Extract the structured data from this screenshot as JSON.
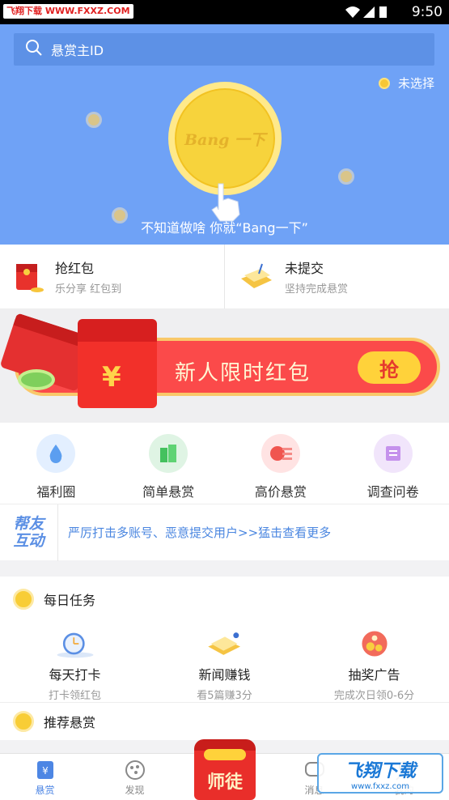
{
  "statusbar": {
    "watermark": "飞翔下载 WWW.FXXZ.COM",
    "time": "9:50"
  },
  "hero": {
    "search_placeholder": "悬赏主ID",
    "unselected_label": "未选择",
    "coin_text": "Bang 一下",
    "hint": "不知道做啥 你就“Bang一下”"
  },
  "quick": [
    {
      "title": "抢红包",
      "subtitle": "乐分享 红包到"
    },
    {
      "title": "未提交",
      "subtitle": "坚持完成悬赏"
    }
  ],
  "banner": {
    "text": "新人限时红包",
    "grab": "抢",
    "yen": "¥"
  },
  "categories": [
    {
      "label": "福利圈",
      "color": "#e3efff",
      "icon": "water-drop-icon"
    },
    {
      "label": "简单悬赏",
      "color": "#dff4e4",
      "icon": "buildings-icon"
    },
    {
      "label": "高价悬赏",
      "color": "#ffe3e3",
      "icon": "money-icon"
    },
    {
      "label": "调查问卷",
      "color": "#f1e5fb",
      "icon": "scroll-icon"
    }
  ],
  "notice": {
    "logo_line1": "帮友",
    "logo_line2": "互动",
    "message": "严厉打击多账号、恶意提交用户>>猛击查看更多"
  },
  "daily": {
    "title": "每日任务",
    "tasks": [
      {
        "title": "每天打卡",
        "subtitle": "打卡领红包",
        "icon": "clock-icon"
      },
      {
        "title": "新闻赚钱",
        "subtitle": "看5篇赚3分",
        "icon": "news-icon"
      },
      {
        "title": "抽奖广告",
        "subtitle": "完成次日领0-6分",
        "icon": "lottery-icon"
      }
    ]
  },
  "recommend": {
    "title": "推荐悬赏"
  },
  "tabbar": {
    "items": [
      {
        "label": "悬赏",
        "icon": "reward-icon"
      },
      {
        "label": "发现",
        "icon": "discover-icon"
      },
      {
        "label": "",
        "icon": "center"
      },
      {
        "label": "消息",
        "icon": "message-icon"
      },
      {
        "label": "我的",
        "icon": "profile-icon"
      }
    ],
    "center_label": "师徒"
  },
  "corner_watermark": {
    "big": "飞翔下载",
    "small": "www.fxxz.com"
  }
}
